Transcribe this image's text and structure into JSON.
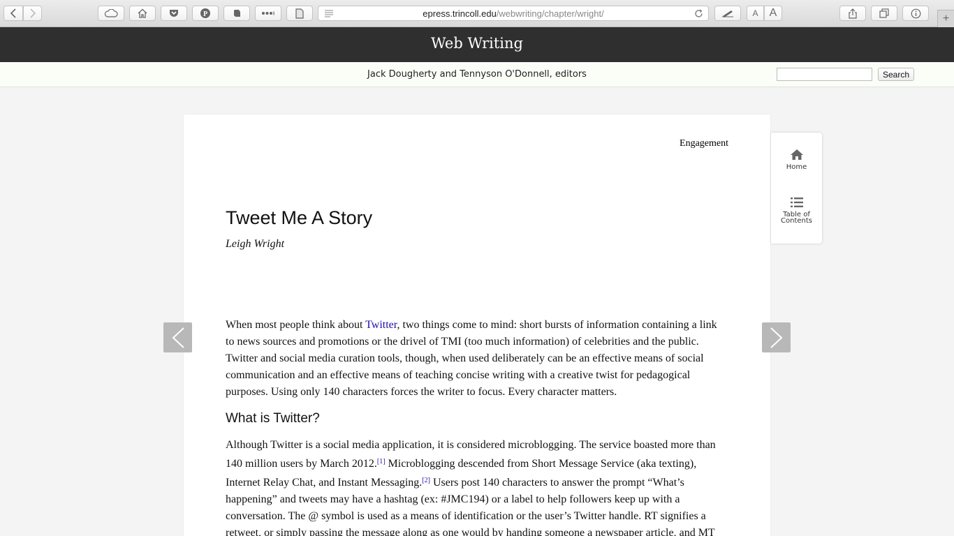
{
  "browser": {
    "url_host": "epress.trincoll.edu",
    "url_path": "/webwriting/chapter/wright/",
    "reader_small_font": "A",
    "reader_large_font": "A",
    "new_tab": "+"
  },
  "site": {
    "title": "Web Writing",
    "editors": "Jack Dougherty and Tennyson O'Donnell, editors",
    "search": {
      "value": "",
      "button_label": "Search"
    }
  },
  "chapter": {
    "part_label": "Engagement",
    "title": "Tweet Me A Story",
    "author": "Leigh Wright",
    "para1": {
      "before_link": "When most people think about ",
      "link": "Twitter",
      "after_link": ", two things come to mind: short bursts of information containing a link to news sources and promotions or the drivel of TMI (too much information) of celebrities and the public. Twitter and social media curation tools, though, when used deliberately can be an effective means of social communication and an effective means of teaching concise writing with a creative twist for pedagogical purposes. Using only 140 characters forces the writer to focus. Every character matters."
    },
    "section_heading": "What is Twitter?",
    "para2": {
      "part1": "Although Twitter is a social media application, it is considered microblogging. The service boasted more than 140 million users by March 2012.",
      "fn1": "[1]",
      "part2": " Microblogging descended from Short Message Service (aka texting), Internet Relay Chat, and Instant Messaging.",
      "fn2": "[2]",
      "part3": " Users post 140 characters to answer the prompt “What’s happening” and tweets may have a hashtag (ex: #JMC194) or a label to help followers keep up with a conversation. The @ symbol is used as a means of identification or the user’s Twitter handle. RT signifies a retweet, or simply passing the message along as one would by handing someone a newspaper article, and MT"
    }
  },
  "side_nav": {
    "home_label": "Home",
    "toc_line1": "Table of",
    "toc_line2": "Contents"
  },
  "icons": {
    "back": "chevron-left-icon",
    "forward": "chevron-right-icon",
    "cloud": "cloud-icon",
    "home": "home-icon",
    "pocket": "pocket-icon",
    "pinterest": "pinterest-icon",
    "evernote": "evernote-icon",
    "more": "more-icon",
    "page": "document-icon",
    "reader": "reader-lines-icon",
    "reload": "reload-icon",
    "annotate": "pen-icon",
    "share": "share-icon",
    "tabs": "tabs-icon",
    "info": "info-icon"
  },
  "colors": {
    "header_bg": "#2f2f2f",
    "link": "#1a0dab",
    "arrow_bg": "#b8b8b8"
  }
}
